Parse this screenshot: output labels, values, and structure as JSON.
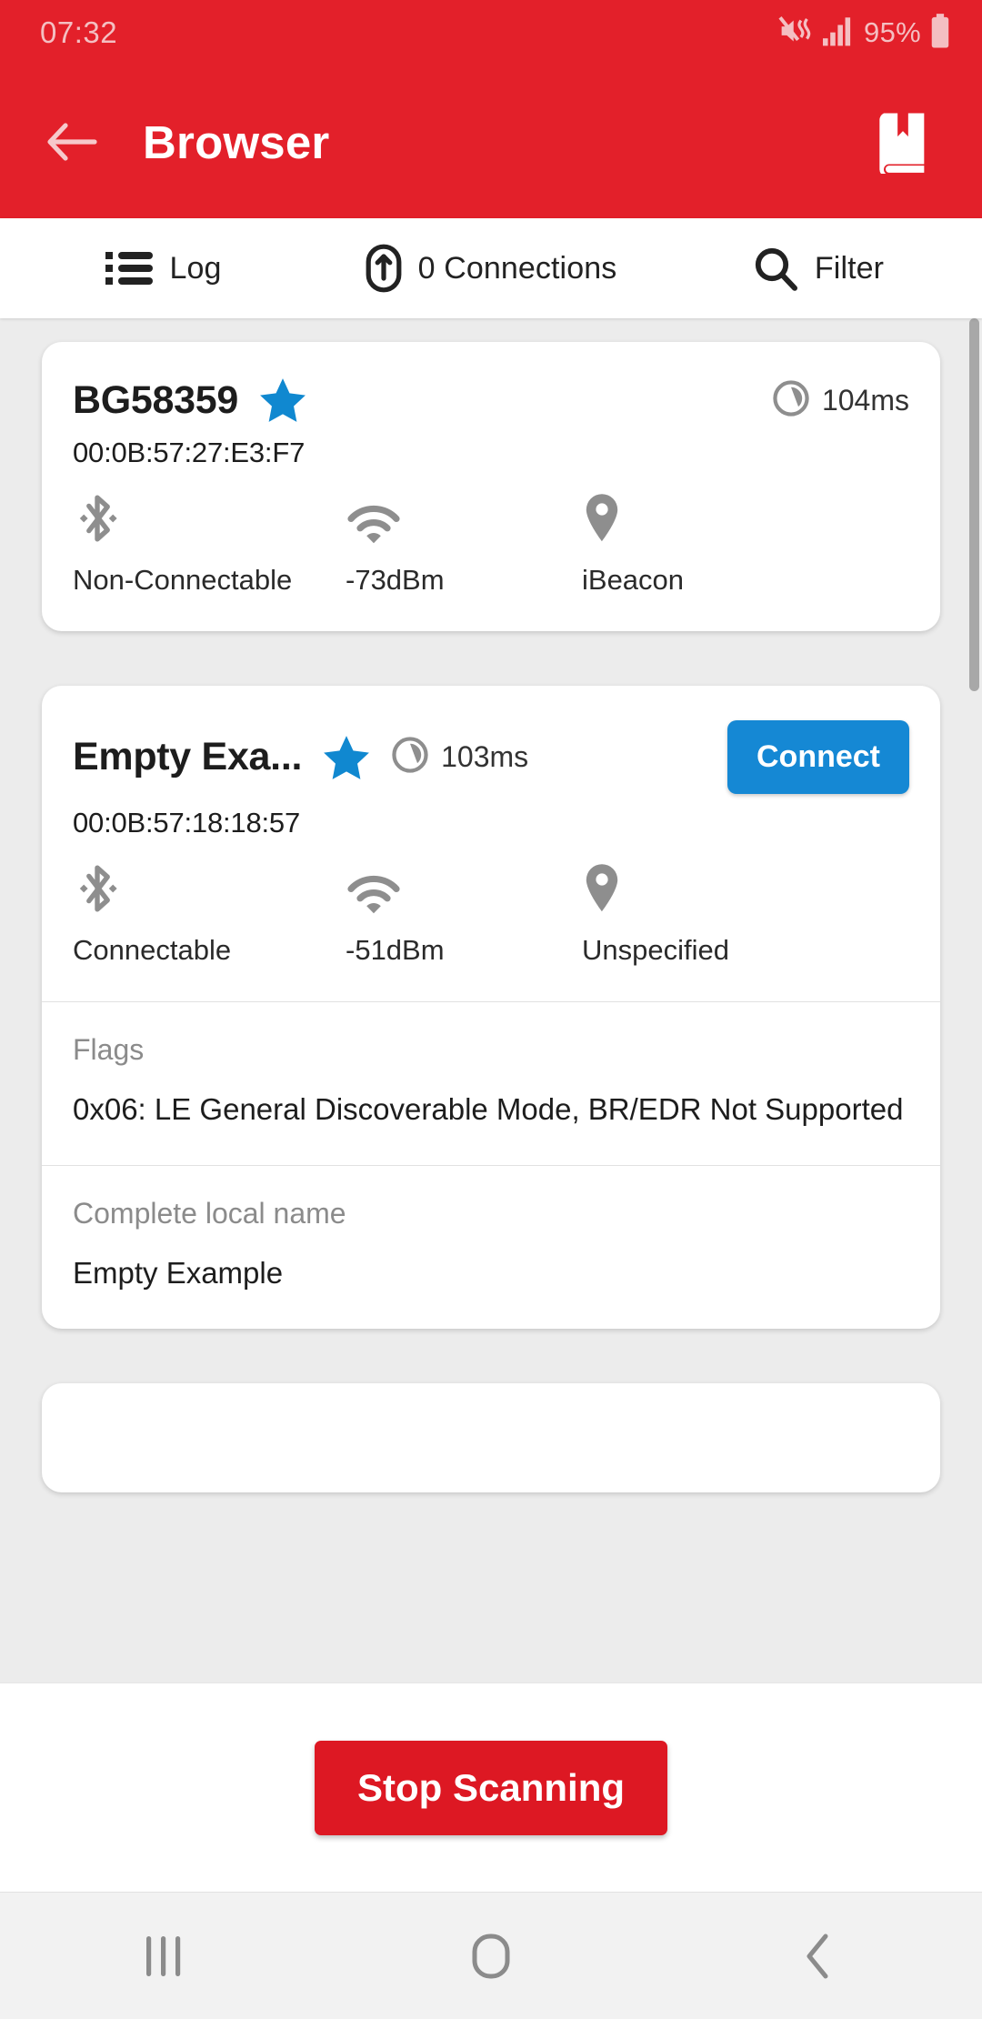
{
  "status_bar": {
    "time": "07:32",
    "battery_percent": "95%",
    "icons": [
      "mute-vibrate-icon",
      "signal-bars-icon",
      "battery-icon"
    ]
  },
  "app_bar": {
    "title": "Browser",
    "back_icon": "arrow-left-icon",
    "bookmark_icon": "book-icon",
    "background_color": "#E3202A"
  },
  "tab_bar": {
    "tabs": [
      {
        "label": "Log",
        "icon": "list-icon"
      },
      {
        "label": "0 Connections",
        "icon": "link-icon"
      },
      {
        "label": "Filter",
        "icon": "search-icon"
      }
    ]
  },
  "devices": [
    {
      "name": "BG58359",
      "favorite": true,
      "timing": "104ms",
      "mac": "00:0B:57:27:E3:F7",
      "connectable_label": "Non-Connectable",
      "rssi": "-73dBm",
      "type": "iBeacon",
      "has_connect_button": false,
      "sections": []
    },
    {
      "name": "Empty Exa...",
      "favorite": true,
      "timing": "103ms",
      "mac": "00:0B:57:18:18:57",
      "connectable_label": "Connectable",
      "rssi": "-51dBm",
      "type": "Unspecified",
      "has_connect_button": true,
      "connect_label": "Connect",
      "sections": [
        {
          "title": "Flags",
          "value": "0x06: LE General Discoverable Mode, BR/EDR Not Supported"
        },
        {
          "title": "Complete local name",
          "value": "Empty Example"
        }
      ]
    }
  ],
  "bottom_bar": {
    "stop_label": "Stop Scanning",
    "color": "#DD1823"
  },
  "nav_bar": {
    "items": [
      {
        "icon": "recents-icon"
      },
      {
        "icon": "home-icon"
      },
      {
        "icon": "back-icon"
      }
    ]
  },
  "accent_colors": {
    "star": "#1088D0",
    "connect": "#1588D4",
    "brand_red": "#E3202A"
  }
}
